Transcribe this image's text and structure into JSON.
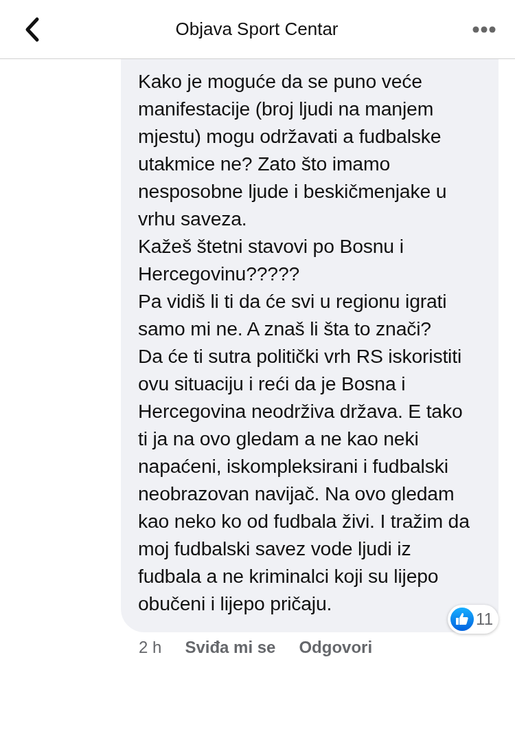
{
  "header": {
    "title": "Objava Sport Centar"
  },
  "comment": {
    "paragraphs": [
      "Kako je moguće da se puno veće manifestacije (broj ljudi na manjem mjestu) mogu održavati a fudbalske utakmice ne? Zato što imamo nesposobne ljude i beskičmenjake u vrhu saveza.",
      "Kažeš štetni stavovi po Bosnu i Hercegovinu?????",
      "Pa vidiš li ti da će svi u regionu igrati samo mi ne. A znaš li šta to znači?",
      "Da će ti sutra politički vrh RS iskoristiti ovu situaciju i reći da je Bosna i Hercegovina neodrživa država. E tako ti ja na ovo gledam a ne kao neki napaćeni, iskompleksirani i fudbalski neobrazovan navijač. Na ovo gledam kao neko ko od fudbala živi. I tražim da moj fudbalski savez vode ljudi iz fudbala a ne kriminalci koji su lijepo obučeni i lijepo pričaju."
    ],
    "time": "2 h",
    "actions": [
      "Sviđa mi se",
      "Odgovori"
    ],
    "reaction_count": "11"
  }
}
